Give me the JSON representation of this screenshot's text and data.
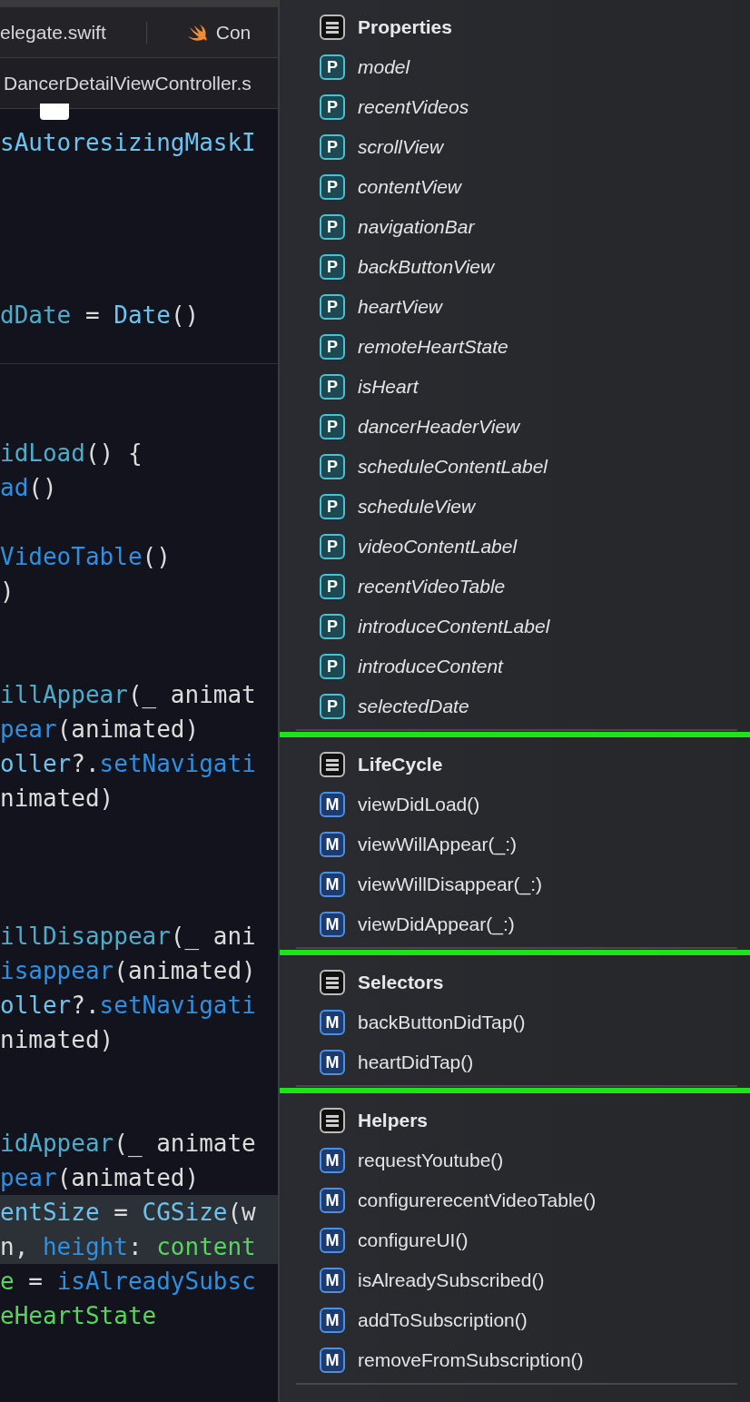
{
  "editor": {
    "tabs": [
      {
        "label": "elegate.swift",
        "icon": false
      },
      {
        "label": "Con",
        "icon": true
      }
    ],
    "jump_bar": "DancerDetailViewController.s",
    "lines": [
      {
        "tokens": [
          {
            "text": "sAutoresizingMaskI",
            "kind": "prop"
          }
        ]
      },
      {
        "tokens": [
          {
            "text": "dDate",
            "kind": "decl"
          },
          {
            "text": " = ",
            "kind": "plain"
          },
          {
            "text": "Date",
            "kind": "prop"
          },
          {
            "text": "()",
            "kind": "plain"
          }
        ]
      },
      {
        "tokens": [
          {
            "text": "idLoad",
            "kind": "decl"
          },
          {
            "text": "() {",
            "kind": "plain"
          }
        ]
      },
      {
        "tokens": [
          {
            "text": "ad",
            "kind": "call"
          },
          {
            "text": "()",
            "kind": "plain"
          }
        ]
      },
      {
        "tokens": [
          {
            "text": "VideoTable",
            "kind": "call"
          },
          {
            "text": "()",
            "kind": "plain"
          }
        ]
      },
      {
        "tokens": [
          {
            "text": ")",
            "kind": "plain"
          }
        ]
      },
      {
        "tokens": [
          {
            "text": "illAppear",
            "kind": "decl"
          },
          {
            "text": "(_ animat",
            "kind": "plain"
          }
        ]
      },
      {
        "tokens": [
          {
            "text": "pear",
            "kind": "call"
          },
          {
            "text": "(animated)",
            "kind": "plain"
          }
        ]
      },
      {
        "tokens": [
          {
            "text": "oller",
            "kind": "prop"
          },
          {
            "text": "?.",
            "kind": "plain"
          },
          {
            "text": "setNavigati",
            "kind": "call"
          }
        ]
      },
      {
        "tokens": [
          {
            "text": "nimated)",
            "kind": "plain"
          }
        ]
      },
      {
        "tokens": [
          {
            "text": "illDisappear",
            "kind": "decl"
          },
          {
            "text": "(_ ani",
            "kind": "plain"
          }
        ]
      },
      {
        "tokens": [
          {
            "text": "isappear",
            "kind": "call"
          },
          {
            "text": "(animated)",
            "kind": "plain"
          }
        ]
      },
      {
        "tokens": [
          {
            "text": "oller",
            "kind": "prop"
          },
          {
            "text": "?.",
            "kind": "plain"
          },
          {
            "text": "setNavigati",
            "kind": "call"
          }
        ]
      },
      {
        "tokens": [
          {
            "text": "nimated)",
            "kind": "plain"
          }
        ]
      },
      {
        "tokens": [
          {
            "text": "idAppear",
            "kind": "decl"
          },
          {
            "text": "(_ animate",
            "kind": "plain"
          }
        ]
      },
      {
        "tokens": [
          {
            "text": "pear",
            "kind": "call"
          },
          {
            "text": "(animated)",
            "kind": "plain"
          }
        ]
      },
      {
        "highlighted": true,
        "tokens": [
          {
            "text": "entSize",
            "kind": "prop"
          },
          {
            "text": " = ",
            "kind": "plain"
          },
          {
            "text": "CGSize",
            "kind": "prop"
          },
          {
            "text": "(w",
            "kind": "plain"
          }
        ]
      },
      {
        "highlighted": true,
        "tokens": [
          {
            "text": "n, ",
            "kind": "plain"
          },
          {
            "text": "height",
            "kind": "call"
          },
          {
            "text": ": ",
            "kind": "plain"
          },
          {
            "text": "content",
            "kind": "local"
          }
        ]
      },
      {
        "tokens": [
          {
            "text": "e",
            "kind": "local"
          },
          {
            "text": " = ",
            "kind": "plain"
          },
          {
            "text": "isAlreadySubsc",
            "kind": "call"
          }
        ]
      },
      {
        "tokens": [
          {
            "text": "eHeartState",
            "kind": "local"
          }
        ]
      }
    ]
  },
  "menu": {
    "sections": [
      {
        "title": "Properties",
        "marked": true,
        "items": [
          {
            "kind": "property",
            "badge": "P",
            "label": "model"
          },
          {
            "kind": "property",
            "badge": "P",
            "label": "recentVideos"
          },
          {
            "kind": "property",
            "badge": "P",
            "label": "scrollView"
          },
          {
            "kind": "property",
            "badge": "P",
            "label": "contentView"
          },
          {
            "kind": "property",
            "badge": "P",
            "label": "navigationBar"
          },
          {
            "kind": "property",
            "badge": "P",
            "label": "backButtonView"
          },
          {
            "kind": "property",
            "badge": "P",
            "label": "heartView"
          },
          {
            "kind": "property",
            "badge": "P",
            "label": "remoteHeartState"
          },
          {
            "kind": "property",
            "badge": "P",
            "label": "isHeart"
          },
          {
            "kind": "property",
            "badge": "P",
            "label": "dancerHeaderView"
          },
          {
            "kind": "property",
            "badge": "P",
            "label": "scheduleContentLabel"
          },
          {
            "kind": "property",
            "badge": "P",
            "label": "scheduleView"
          },
          {
            "kind": "property",
            "badge": "P",
            "label": "videoContentLabel"
          },
          {
            "kind": "property",
            "badge": "P",
            "label": "recentVideoTable"
          },
          {
            "kind": "property",
            "badge": "P",
            "label": "introduceContentLabel"
          },
          {
            "kind": "property",
            "badge": "P",
            "label": "introduceContent"
          },
          {
            "kind": "property",
            "badge": "P",
            "label": "selectedDate"
          }
        ]
      },
      {
        "title": "LifeCycle",
        "marked": true,
        "items": [
          {
            "kind": "method",
            "badge": "M",
            "label": "viewDidLoad()"
          },
          {
            "kind": "method",
            "badge": "M",
            "label": "viewWillAppear(_:)"
          },
          {
            "kind": "method",
            "badge": "M",
            "label": "viewWillDisappear(_:)"
          },
          {
            "kind": "method",
            "badge": "M",
            "label": "viewDidAppear(_:)"
          }
        ]
      },
      {
        "title": "Selectors",
        "marked": true,
        "items": [
          {
            "kind": "method",
            "badge": "M",
            "label": "backButtonDidTap()"
          },
          {
            "kind": "method",
            "badge": "M",
            "label": "heartDidTap()"
          }
        ]
      },
      {
        "title": "Helpers",
        "items": [
          {
            "kind": "method",
            "badge": "M",
            "label": "requestYoutube()"
          },
          {
            "kind": "method",
            "badge": "M",
            "label": "configurerecentVideoTable()"
          },
          {
            "kind": "method",
            "badge": "M",
            "label": "configureUI()"
          },
          {
            "kind": "method",
            "badge": "M",
            "label": "isAlreadySubscribed()"
          },
          {
            "kind": "method",
            "badge": "M",
            "label": "addToSubscription()"
          },
          {
            "kind": "method",
            "badge": "M",
            "label": "removeFromSubscription()"
          }
        ]
      }
    ]
  }
}
